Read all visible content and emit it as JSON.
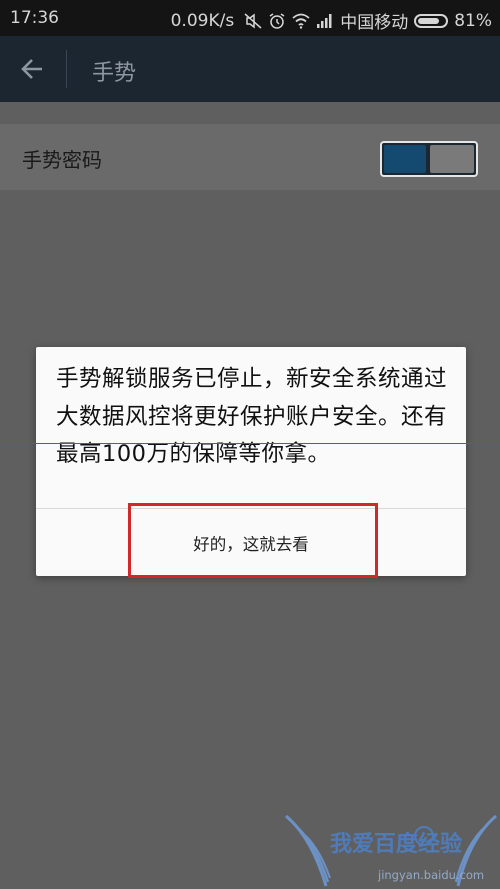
{
  "status_bar": {
    "time": "17:36",
    "network_speed": "0.09K/s",
    "carrier": "中国移动",
    "battery_percent": "81%",
    "battery_level": 0.81,
    "icons": [
      "mute-icon",
      "alarm-icon",
      "wifi-icon",
      "signal-icon",
      "battery-icon"
    ]
  },
  "header": {
    "title": "手势",
    "back_icon": "back-arrow-icon"
  },
  "settings": {
    "gesture_password": {
      "label": "手势密码",
      "enabled": true
    }
  },
  "dialog": {
    "message": "手势解锁服务已停止，新安全系统通过大数据风控将更好保护账户安全。还有最高100万的保障等你拿。",
    "ok_label": "好的，这就去看"
  },
  "watermark": {
    "brand": "我爱百度经验",
    "url": "jingyan.baidu.com"
  },
  "colors": {
    "header_bg": "#1c2631",
    "overlay_bg": "#5f5f5f",
    "toggle_on": "#144a6f",
    "highlight": "#d2282c",
    "watermark": "#4d80c9"
  }
}
